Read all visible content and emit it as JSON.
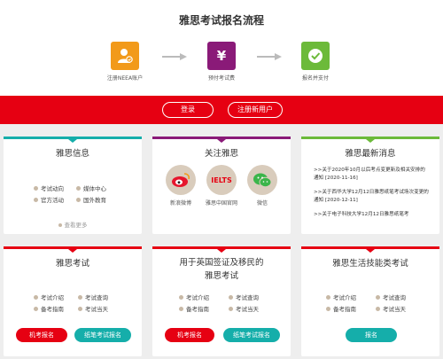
{
  "colors": {
    "brand_red": "#e60012",
    "teal": "#15aeaa",
    "green": "#6cba3a",
    "purple": "#8a1a78",
    "orange": "#f29a1a"
  },
  "header": {
    "title": "雅思考试报名流程",
    "steps": [
      {
        "icon": "user-register-icon",
        "label": "注册NEEA账户"
      },
      {
        "icon": "yen-payment-icon",
        "label": "预付考试费"
      },
      {
        "icon": "check-icon",
        "label": "报名并支付"
      }
    ]
  },
  "banner": {
    "login_label": "登录",
    "register_label": "注册新用户"
  },
  "info_card": {
    "title": "雅思信息",
    "links": [
      "考试动向",
      "媒体中心",
      "官方活动",
      "国外教育"
    ],
    "more": "查看更多"
  },
  "follow_card": {
    "title": "关注雅思",
    "items": [
      {
        "icon": "weibo-icon",
        "label": "新浪微博"
      },
      {
        "icon": "ielts-logo",
        "label": "雅思中国官网",
        "logo_text": "IELTS"
      },
      {
        "icon": "wechat-icon",
        "label": "微信"
      }
    ]
  },
  "news_card": {
    "title": "雅思最新消息",
    "items": [
      ">>关于2020年10月以后考点变更新及相关安排的通知 [2020-11-16]",
      ">>关于西华大学12月12日雅思纸笔考试场次变更的通知 [2020-12-11]",
      ">>关于电子科技大学12月12日雅思纸笔考"
    ]
  },
  "exam_card": {
    "title": "雅思考试",
    "links": [
      "考试介绍",
      "考试查询",
      "备考指南",
      "考试当天"
    ],
    "buttons": [
      "机考报名",
      "纸笔考试报名"
    ]
  },
  "ukvi_card": {
    "title_line1": "用于英国签证及移民的",
    "title_line2": "雅思考试",
    "links": [
      "考试介绍",
      "考试查询",
      "备考指南",
      "考试当天"
    ],
    "buttons": [
      "机考报名",
      "纸笔考试报名"
    ]
  },
  "life_card": {
    "title": "雅思生活技能类考试",
    "links": [
      "考试介绍",
      "考试查询",
      "备考指南",
      "考试当天"
    ],
    "buttons": [
      "报名"
    ]
  }
}
